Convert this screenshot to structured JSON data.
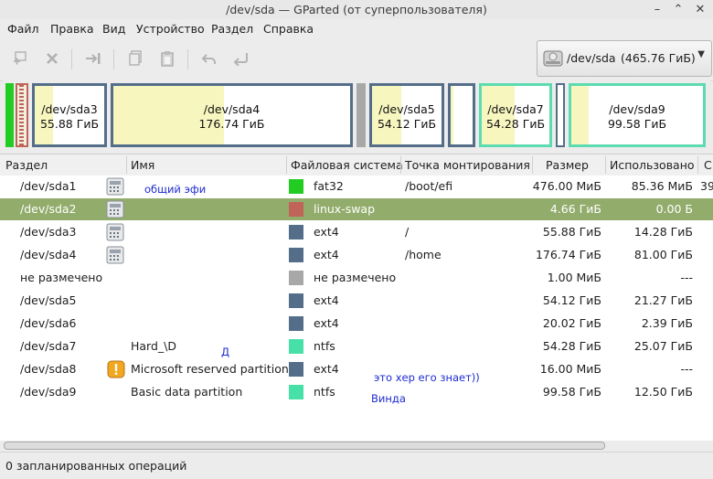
{
  "window": {
    "title": "/dev/sda — GParted (от суперпользователя)"
  },
  "menu": [
    "Файл",
    "Правка",
    "Вид",
    "Устройство",
    "Раздел",
    "Справка"
  ],
  "toolbar": {
    "buttons": [
      "new-partition-icon",
      "delete-icon",
      "resize-move-icon",
      "copy-icon",
      "paste-icon",
      "undo-icon",
      "apply-icon"
    ]
  },
  "device": {
    "name": "/dev/sda",
    "size": "(465.76 ГиБ)"
  },
  "diskmap": [
    {
      "name": "/dev/sda3",
      "size": "55.88 ГиБ",
      "color": "#546e8a"
    },
    {
      "name": "/dev/sda4",
      "size": "176.74 ГиБ",
      "color": "#546e8a"
    },
    {
      "name": "/dev/sda5",
      "size": "54.12 ГиБ",
      "color": "#546e8a"
    },
    {
      "name": "/dev/sda7",
      "size": "54.28 ГиБ",
      "color": "#5ddbb0"
    },
    {
      "name": "/dev/sda9",
      "size": "99.58 ГиБ",
      "color": "#5ddbb0"
    }
  ],
  "columns": [
    "Раздел",
    "Имя",
    "Файловая система",
    "Точка монтирования",
    "Размер",
    "Использовано",
    "С"
  ],
  "rows": [
    {
      "partition": "/dev/sda1",
      "name": "",
      "fs": "fat32",
      "color": "#22cc22",
      "mount": "/boot/efi",
      "size": "476.00 МиБ",
      "used": "85.36 МиБ",
      "extra": "39"
    },
    {
      "partition": "/dev/sda2",
      "name": "",
      "fs": "linux-swap",
      "color": "#c0645a",
      "mount": "",
      "size": "4.66 ГиБ",
      "used": "0.00 Б",
      "extra": ""
    },
    {
      "partition": "/dev/sda3",
      "name": "",
      "fs": "ext4",
      "color": "#546e8a",
      "mount": "/",
      "size": "55.88 ГиБ",
      "used": "14.28 ГиБ",
      "extra": ""
    },
    {
      "partition": "/dev/sda4",
      "name": "",
      "fs": "ext4",
      "color": "#546e8a",
      "mount": "/home",
      "size": "176.74 ГиБ",
      "used": "81.00 ГиБ",
      "extra": ""
    },
    {
      "partition": "не размечено",
      "name": "",
      "fs": "не размечено",
      "color": "#a8a8a8",
      "mount": "",
      "size": "1.00 МиБ",
      "used": "---",
      "extra": ""
    },
    {
      "partition": "/dev/sda5",
      "name": "",
      "fs": "ext4",
      "color": "#546e8a",
      "mount": "",
      "size": "54.12 ГиБ",
      "used": "21.27 ГиБ",
      "extra": ""
    },
    {
      "partition": "/dev/sda6",
      "name": "",
      "fs": "ext4",
      "color": "#546e8a",
      "mount": "",
      "size": "20.02 ГиБ",
      "used": "2.39 ГиБ",
      "extra": ""
    },
    {
      "partition": "/dev/sda7",
      "name": "Hard_\\D",
      "fs": "ntfs",
      "color": "#46e0a8",
      "mount": "",
      "size": "54.28 ГиБ",
      "used": "25.07 ГиБ",
      "extra": ""
    },
    {
      "partition": "/dev/sda8",
      "name": "Microsoft reserved partition",
      "fs": "ext4",
      "color": "#546e8a",
      "mount": "",
      "size": "16.00 МиБ",
      "used": "---",
      "extra": ""
    },
    {
      "partition": "/dev/sda9",
      "name": "Basic data partition",
      "fs": "ntfs",
      "color": "#46e0a8",
      "mount": "",
      "size": "99.58 ГиБ",
      "used": "12.50 ГиБ",
      "extra": ""
    }
  ],
  "annotations": {
    "efi": "общий эфи",
    "d": "Д",
    "unknown": "это хер его знает))",
    "windows": "Винда"
  },
  "status": "0 запланированных операций"
}
